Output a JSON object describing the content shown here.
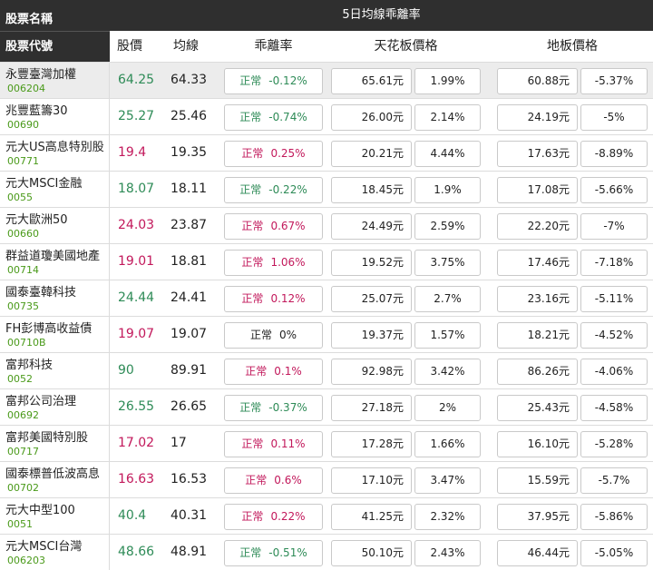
{
  "header": {
    "stock_name": "股票名稱",
    "stock_code": "股票代號",
    "band_title": "5日均線乖離率",
    "col_price": "股價",
    "col_ma": "均線",
    "col_dev": "乖離率",
    "col_ceiling": "天花板價格",
    "col_floor": "地板價格"
  },
  "colors": {
    "up": "#c2185b",
    "down": "#2e8b57",
    "code": "#4a9a1a",
    "header_bg": "#2f2f2f"
  },
  "rows": [
    {
      "name": "永豐臺灣加權",
      "code": "006204",
      "price": "64.25",
      "ma": "64.33",
      "status": "正常",
      "dev": "-0.12%",
      "ceiling": "65.61元",
      "ceiling_pct": "1.99%",
      "floor": "60.88元",
      "floor_pct": "-5.37%",
      "trend": "down",
      "highlight": true
    },
    {
      "name": "兆豐藍籌30",
      "code": "00690",
      "price": "25.27",
      "ma": "25.46",
      "status": "正常",
      "dev": "-0.74%",
      "ceiling": "26.00元",
      "ceiling_pct": "2.14%",
      "floor": "24.19元",
      "floor_pct": "-5%",
      "trend": "down"
    },
    {
      "name": "元大US高息特別股",
      "code": "00771",
      "price": "19.4",
      "ma": "19.35",
      "status": "正常",
      "dev": "0.25%",
      "ceiling": "20.21元",
      "ceiling_pct": "4.44%",
      "floor": "17.63元",
      "floor_pct": "-8.89%",
      "trend": "up"
    },
    {
      "name": "元大MSCI金融",
      "code": "0055",
      "price": "18.07",
      "ma": "18.11",
      "status": "正常",
      "dev": "-0.22%",
      "ceiling": "18.45元",
      "ceiling_pct": "1.9%",
      "floor": "17.08元",
      "floor_pct": "-5.66%",
      "trend": "down"
    },
    {
      "name": "元大歐洲50",
      "code": "00660",
      "price": "24.03",
      "ma": "23.87",
      "status": "正常",
      "dev": "0.67%",
      "ceiling": "24.49元",
      "ceiling_pct": "2.59%",
      "floor": "22.20元",
      "floor_pct": "-7%",
      "trend": "up"
    },
    {
      "name": "群益道瓊美國地產",
      "code": "00714",
      "price": "19.01",
      "ma": "18.81",
      "status": "正常",
      "dev": "1.06%",
      "ceiling": "19.52元",
      "ceiling_pct": "3.75%",
      "floor": "17.46元",
      "floor_pct": "-7.18%",
      "trend": "up"
    },
    {
      "name": "國泰臺韓科技",
      "code": "00735",
      "price": "24.44",
      "ma": "24.41",
      "status": "正常",
      "dev": "0.12%",
      "ceiling": "25.07元",
      "ceiling_pct": "2.7%",
      "floor": "23.16元",
      "floor_pct": "-5.11%",
      "trend": "down_price_up_dev"
    },
    {
      "name": "FH彭博高收益債",
      "code": "00710B",
      "price": "19.07",
      "ma": "19.07",
      "status": "正常",
      "dev": "0%",
      "ceiling": "19.37元",
      "ceiling_pct": "1.57%",
      "floor": "18.21元",
      "floor_pct": "-4.52%",
      "trend": "flat_price_up"
    },
    {
      "name": "富邦科技",
      "code": "0052",
      "price": "90",
      "ma": "89.91",
      "status": "正常",
      "dev": "0.1%",
      "ceiling": "92.98元",
      "ceiling_pct": "3.42%",
      "floor": "86.26元",
      "floor_pct": "-4.06%",
      "trend": "down_price_up_dev"
    },
    {
      "name": "富邦公司治理",
      "code": "00692",
      "price": "26.55",
      "ma": "26.65",
      "status": "正常",
      "dev": "-0.37%",
      "ceiling": "27.18元",
      "ceiling_pct": "2%",
      "floor": "25.43元",
      "floor_pct": "-4.58%",
      "trend": "down"
    },
    {
      "name": "富邦美國特別股",
      "code": "00717",
      "price": "17.02",
      "ma": "17",
      "status": "正常",
      "dev": "0.11%",
      "ceiling": "17.28元",
      "ceiling_pct": "1.66%",
      "floor": "16.10元",
      "floor_pct": "-5.28%",
      "trend": "up"
    },
    {
      "name": "國泰標普低波高息",
      "code": "00702",
      "price": "16.63",
      "ma": "16.53",
      "status": "正常",
      "dev": "0.6%",
      "ceiling": "17.10元",
      "ceiling_pct": "3.47%",
      "floor": "15.59元",
      "floor_pct": "-5.7%",
      "trend": "up"
    },
    {
      "name": "元大中型100",
      "code": "0051",
      "price": "40.4",
      "ma": "40.31",
      "status": "正常",
      "dev": "0.22%",
      "ceiling": "41.25元",
      "ceiling_pct": "2.32%",
      "floor": "37.95元",
      "floor_pct": "-5.86%",
      "trend": "flat_price_up"
    },
    {
      "name": "元大MSCI台灣",
      "code": "006203",
      "price": "48.66",
      "ma": "48.91",
      "status": "正常",
      "dev": "-0.51%",
      "ceiling": "50.10元",
      "ceiling_pct": "2.43%",
      "floor": "46.44元",
      "floor_pct": "-5.05%",
      "trend": "down"
    }
  ]
}
